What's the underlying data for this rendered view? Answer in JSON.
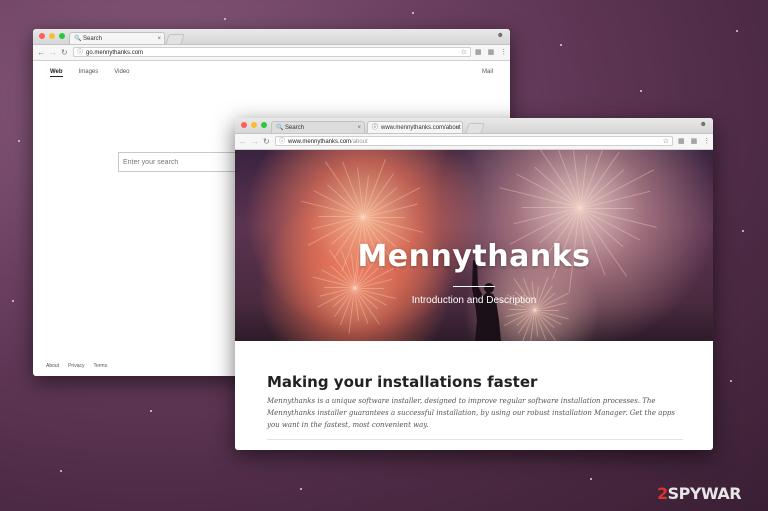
{
  "back_window": {
    "tab": {
      "icon": "magnifier-icon",
      "label": "Search",
      "close": "×"
    },
    "address": "go.mennythanks.com",
    "nav": {
      "web": "Web",
      "images": "Images",
      "video": "Video",
      "mail": "Mail"
    },
    "search_placeholder": "Enter your search",
    "footer": {
      "about": "About",
      "privacy": "Privacy",
      "terms": "Terms"
    }
  },
  "front_window": {
    "tabs": [
      {
        "icon": "magnifier-icon",
        "label": "Search",
        "close": "×"
      },
      {
        "icon": "info-icon",
        "label": "www.mennythanks.com/about",
        "close": "×"
      }
    ],
    "address_host": "www.mennythanks.com",
    "address_path": "/about",
    "hero": {
      "title": "Mennythanks",
      "subtitle": "Introduction and Description"
    },
    "section": {
      "heading": "Making your installations faster",
      "description": "Mennythanks is a unique software installer, designed to improve regular software installation processes. The Mennythanks installer guarantees a successful installation, by using our robust installation Manager. Get the apps you want in the fastest, most convenient way."
    }
  },
  "watermark": {
    "prefix": "2",
    "name": "SPYWAR"
  },
  "colors": {
    "desktop_bg": "#6b3f60",
    "traffic_red": "#fc5f57",
    "traffic_yellow": "#fdbc2e",
    "traffic_green": "#28c840",
    "watermark_red": "#d9342b"
  }
}
